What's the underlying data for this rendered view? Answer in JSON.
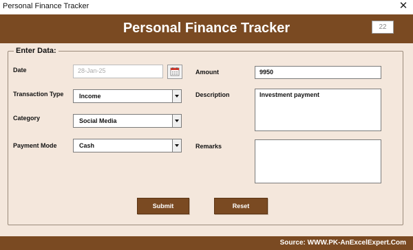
{
  "window": {
    "title": "Personal Finance Tracker",
    "close_glyph": "✕"
  },
  "header": {
    "title": "Personal Finance Tracker",
    "record_id": "22"
  },
  "form": {
    "legend": "Enter Data:",
    "date": {
      "label": "Date",
      "value": "28-Jan-25"
    },
    "transaction_type": {
      "label": "Transaction Type",
      "value": "Income"
    },
    "category": {
      "label": "Category",
      "value": "Social Media"
    },
    "payment_mode": {
      "label": "Payment Mode",
      "value": "Cash"
    },
    "amount": {
      "label": "Amount",
      "value": "9950"
    },
    "description": {
      "label": "Description",
      "value": "Investment payment"
    },
    "remarks": {
      "label": "Remarks",
      "value": ""
    }
  },
  "buttons": {
    "submit": "Submit",
    "reset": "Reset"
  },
  "footer": {
    "source": "Source: WWW.PK-AnExcelExpert.Com"
  },
  "colors": {
    "brand": "#7a4a22",
    "background": "#f4e7dc",
    "calendar_accent": "#d9362a"
  },
  "icons": {
    "calendar": "calendar-icon",
    "dropdown": "chevron-down-icon",
    "close": "close-icon"
  }
}
